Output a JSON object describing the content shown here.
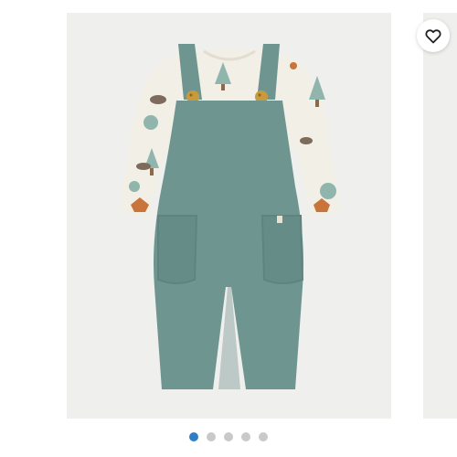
{
  "product_image": {
    "subject": "overall-and-bodysuit-set",
    "colors": {
      "overall": "#6f9590",
      "overall_shadow": "#5f847f",
      "bodysuit": "#f1efe6",
      "buttons": "#c89a3c",
      "background": "#efefed"
    }
  },
  "favorite": {
    "icon": "heart-outline-icon"
  },
  "pagination": {
    "active_index": 0,
    "dots": [
      "slide-1",
      "slide-2",
      "slide-3",
      "slide-4",
      "slide-5"
    ],
    "active_color": "#2f7fc7",
    "inactive_color": "#c9c9c9"
  }
}
